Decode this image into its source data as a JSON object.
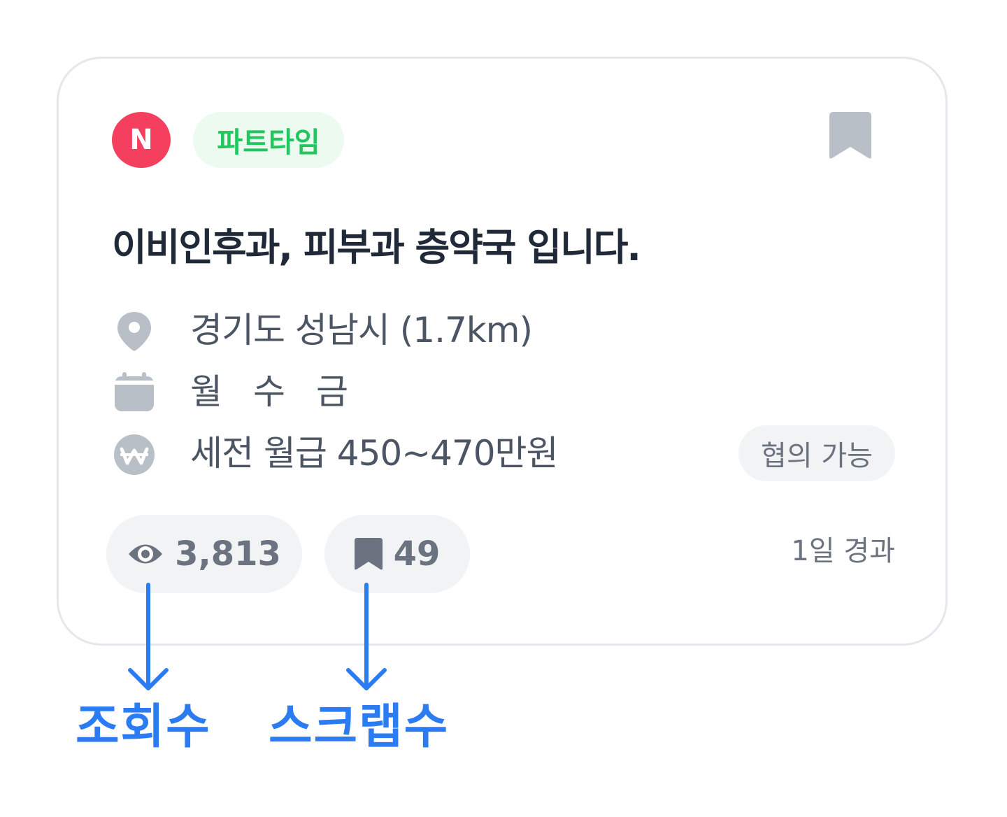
{
  "card": {
    "company_initial": "N",
    "job_type": "파트타임",
    "title": "이비인후과, 피부과 층약국 입니다.",
    "location": "경기도 성남시 (1.7km)",
    "days": [
      "월",
      "수",
      "금"
    ],
    "salary": "세전 월급 450~470만원",
    "negotiable": "협의 가능",
    "views": "3,813",
    "scraps": "49",
    "elapsed": "1일 경과"
  },
  "annotations": {
    "views_label": "조회수",
    "scraps_label": "스크랩수"
  },
  "colors": {
    "avatar": "#f43f5e",
    "job_type_text": "#22c55e",
    "job_type_bg": "#ecfaf0",
    "annotation": "#2b7cf2",
    "icon_gray": "#b8bfc6"
  },
  "icons": [
    "bookmark-icon",
    "location-pin-icon",
    "calendar-icon",
    "won-icon",
    "eye-icon"
  ]
}
